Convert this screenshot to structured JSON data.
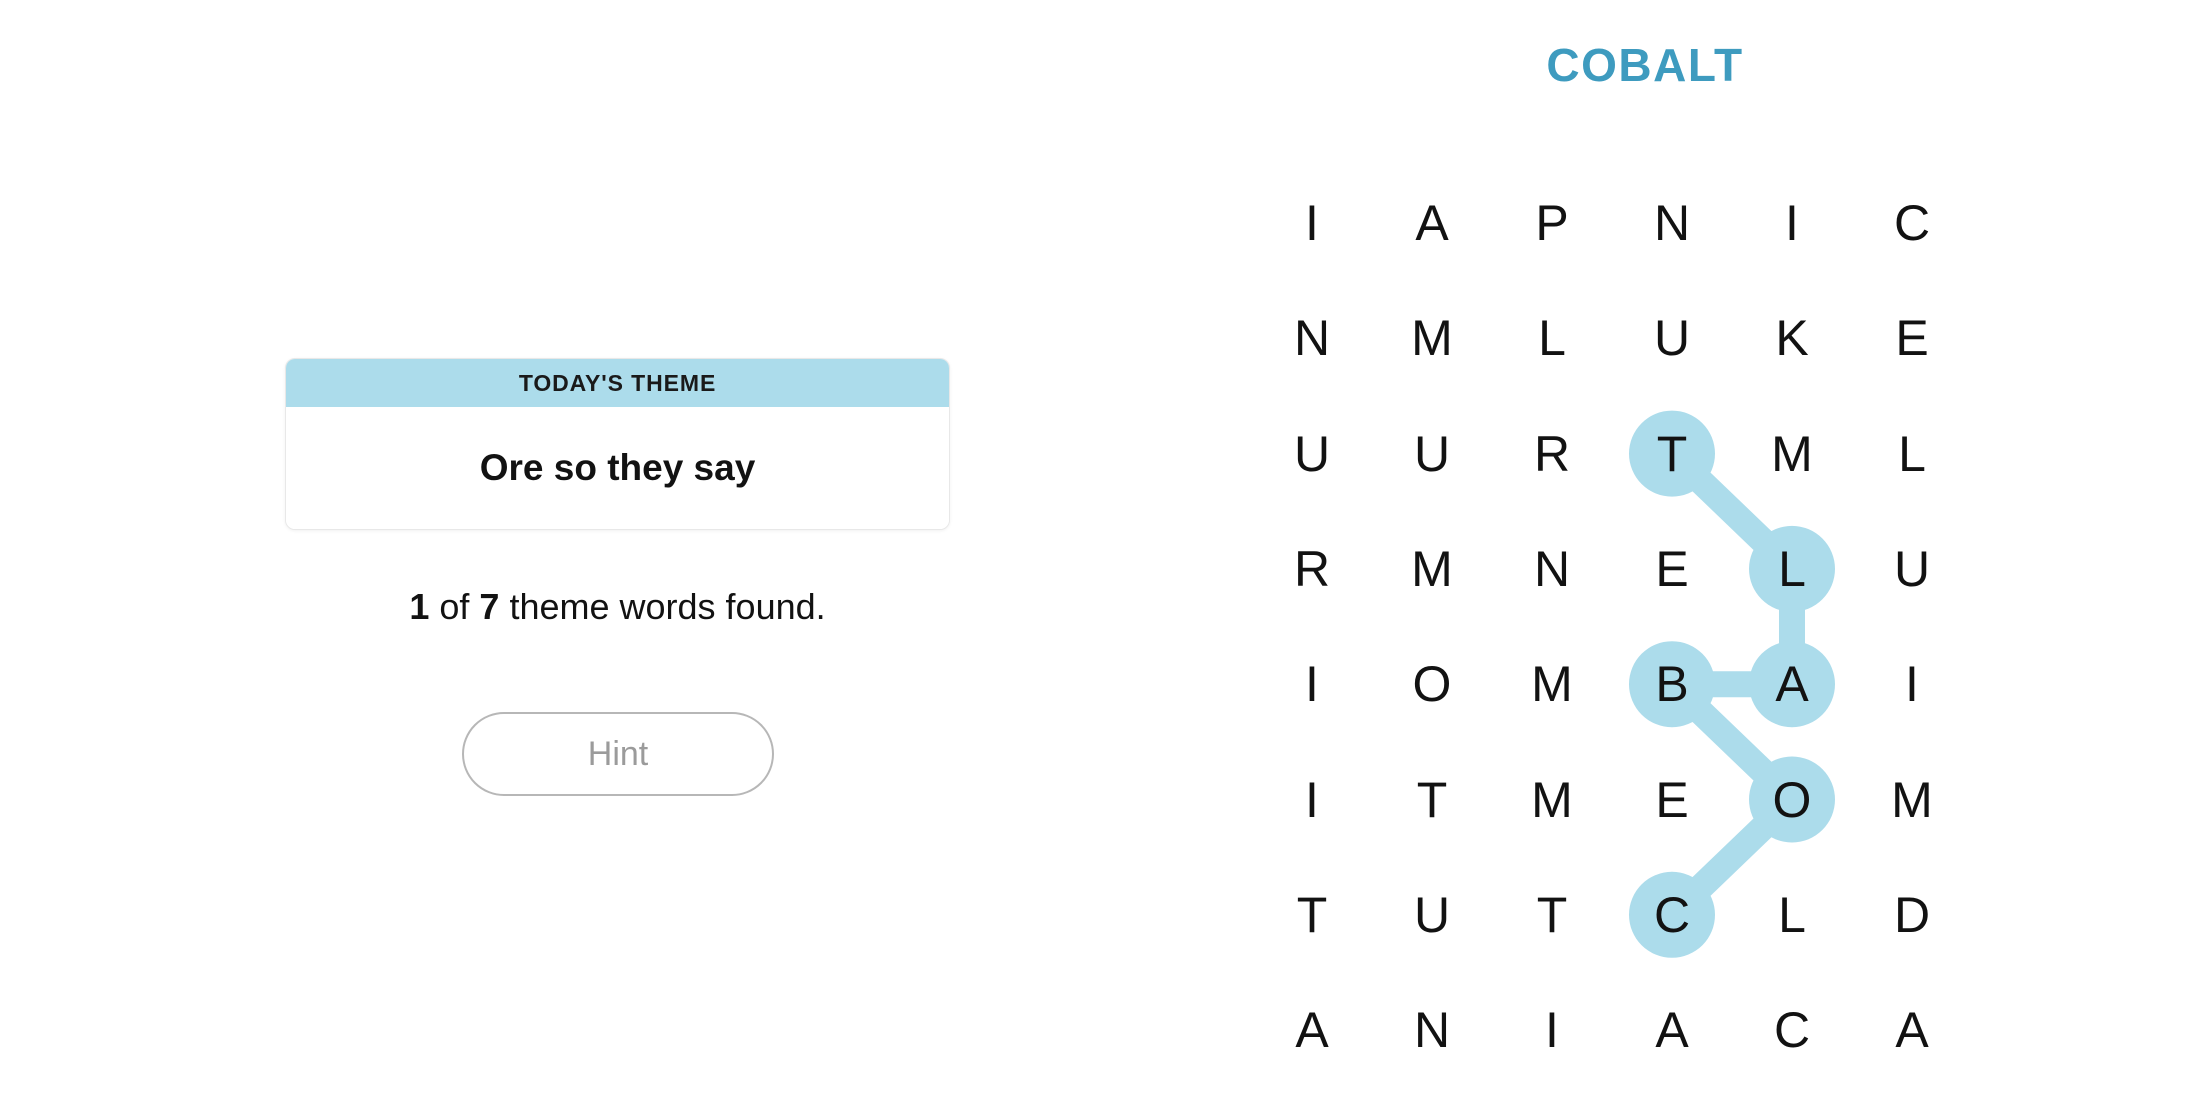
{
  "puzzle": {
    "title": "COBALT",
    "title_color": "#3E9BBF",
    "highlight_color": "#ACDCEB",
    "rows": 8,
    "cols": 6,
    "grid": [
      [
        "I",
        "A",
        "P",
        "N",
        "I",
        "C"
      ],
      [
        "N",
        "M",
        "L",
        "U",
        "K",
        "E"
      ],
      [
        "U",
        "U",
        "R",
        "T",
        "M",
        "L"
      ],
      [
        "R",
        "M",
        "N",
        "E",
        "L",
        "U"
      ],
      [
        "I",
        "O",
        "M",
        "B",
        "A",
        "I"
      ],
      [
        "I",
        "T",
        "M",
        "E",
        "O",
        "M"
      ],
      [
        "T",
        "U",
        "T",
        "C",
        "L",
        "D"
      ],
      [
        "A",
        "N",
        "I",
        "A",
        "C",
        "A"
      ]
    ],
    "found_word": {
      "word": "COBALT",
      "path": [
        {
          "row": 6,
          "col": 3,
          "letter": "C"
        },
        {
          "row": 5,
          "col": 4,
          "letter": "O"
        },
        {
          "row": 4,
          "col": 3,
          "letter": "B"
        },
        {
          "row": 4,
          "col": 4,
          "letter": "A"
        },
        {
          "row": 3,
          "col": 4,
          "letter": "L"
        },
        {
          "row": 2,
          "col": 3,
          "letter": "T"
        }
      ]
    }
  },
  "theme_card": {
    "header_label": "TODAY'S THEME",
    "theme_text": "Ore so they say"
  },
  "progress": {
    "found_count": "1",
    "of_label": "of",
    "total_count": "7",
    "suffix": "theme words found."
  },
  "hint_button": {
    "label": "Hint"
  }
}
